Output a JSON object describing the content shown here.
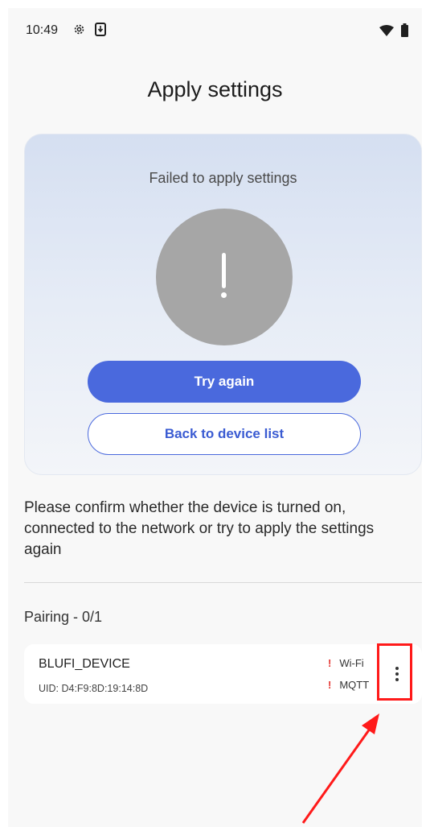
{
  "status_bar": {
    "time": "10:49",
    "icons": [
      "settings-icon",
      "download-icon",
      "wifi-icon",
      "battery-icon"
    ]
  },
  "page": {
    "title": "Apply settings"
  },
  "result_card": {
    "status_text": "Failed to apply settings",
    "icon": "exclamation-icon",
    "primary_button": "Try again",
    "secondary_button": "Back to device list"
  },
  "hint": "Please confirm whether the device is turned on, connected to the network or try to apply the settings again",
  "pairing": {
    "title": "Pairing - 0/1",
    "devices": [
      {
        "name": "BLUFI_DEVICE",
        "uid": "UID: D4:F9:8D:19:14:8D",
        "statuses": [
          {
            "mark": "!",
            "label": "Wi-Fi"
          },
          {
            "mark": "!",
            "label": "MQTT"
          }
        ]
      }
    ]
  },
  "colors": {
    "accent": "#4a69dd",
    "error": "#e53935",
    "highlight": "#ff1a1a",
    "icon_circle": "#a6a6a6"
  }
}
